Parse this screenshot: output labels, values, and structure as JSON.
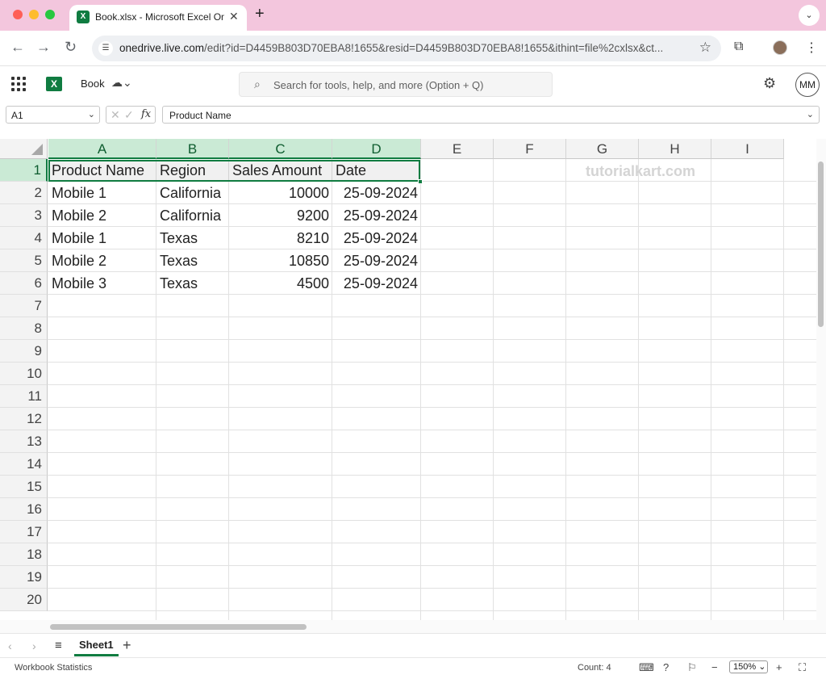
{
  "browser": {
    "tab_title": "Book.xlsx - Microsoft Excel Online",
    "tab_favicon_letter": "X",
    "url_domain": "onedrive.live.com",
    "url_path": "/edit?id=D4459B803D70EBA8!1655&resid=D4459B803D70EBA8!1655&ithint=file%2cxlsx&ct..."
  },
  "excel": {
    "logo_letter": "X",
    "book_name": "Book",
    "search_placeholder": "Search for tools, help, and more (Option + Q)",
    "avatar_initials": "MM",
    "name_box": "A1",
    "fx_label": "fx",
    "formula_value": "Product Name"
  },
  "grid": {
    "columns": [
      "A",
      "B",
      "C",
      "D",
      "E",
      "F",
      "G",
      "H",
      "I"
    ],
    "rows": [
      "1",
      "2",
      "3",
      "4",
      "5",
      "6",
      "7",
      "8",
      "9",
      "10",
      "11",
      "12",
      "13",
      "14",
      "15",
      "16",
      "17",
      "18",
      "19",
      "20"
    ],
    "data": [
      [
        "Product Name",
        "Region",
        "Sales Amount",
        "Date"
      ],
      [
        "Mobile 1",
        "California",
        "10000",
        "25-09-2024"
      ],
      [
        "Mobile 2",
        "California",
        "9200",
        "25-09-2024"
      ],
      [
        "Mobile 1",
        "Texas",
        "8210",
        "25-09-2024"
      ],
      [
        "Mobile 2",
        "Texas",
        "10850",
        "25-09-2024"
      ],
      [
        "Mobile 3",
        "Texas",
        "4500",
        "25-09-2024"
      ]
    ],
    "watermark": "tutorialkart.com"
  },
  "sheets": {
    "active": "Sheet1"
  },
  "status": {
    "workbook_statistics": "Workbook Statistics",
    "count": "Count: 4",
    "zoom": "150%"
  },
  "colors": {
    "excel_green": "#107c41",
    "tab_strip": "#f3c6dd",
    "selection_header": "#caead5"
  },
  "icons": [
    "back-icon",
    "forward-icon",
    "reload-icon",
    "site-info-icon",
    "star-icon",
    "extensions-icon",
    "kebab-icon",
    "app-launcher-icon",
    "cloud-sync-icon",
    "search-icon",
    "gear-icon"
  ]
}
